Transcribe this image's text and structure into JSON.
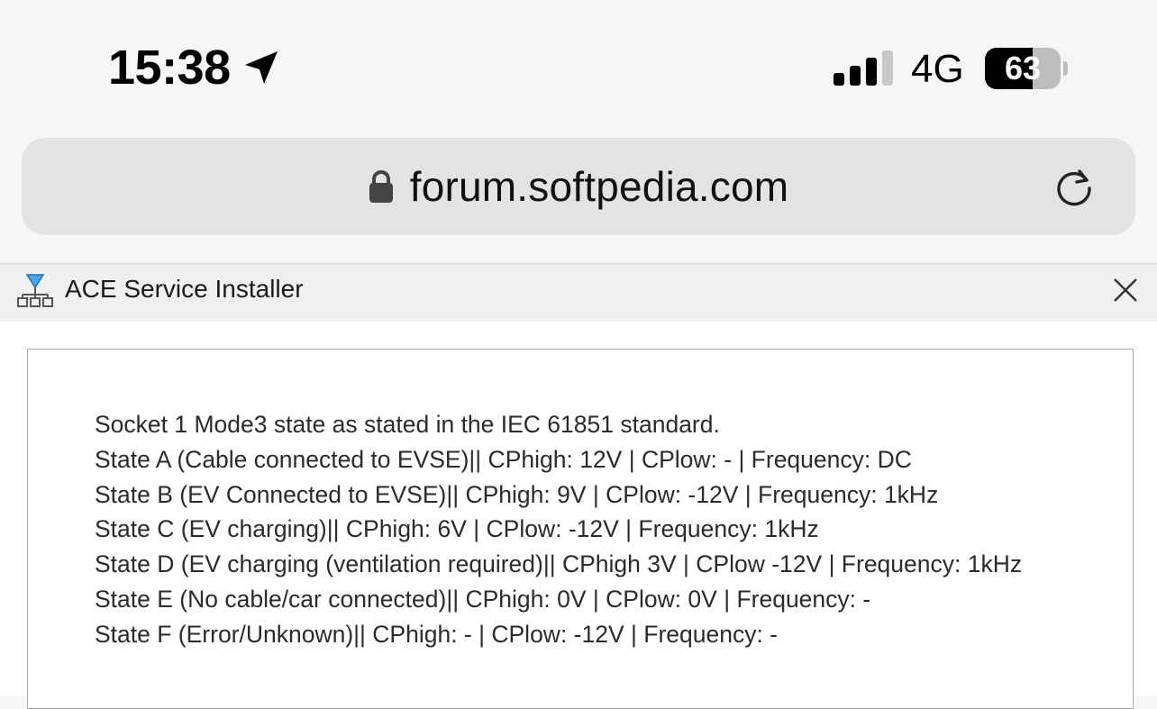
{
  "status_bar": {
    "time": "15:38",
    "location_icon": "location-arrow-icon",
    "signal_icon": "cellular-signal-icon",
    "signal_bars_active": 3,
    "signal_bars_total": 4,
    "network": "4G",
    "battery_percent": "63",
    "battery_level": 0.63
  },
  "browser": {
    "lock_icon": "lock-icon",
    "url": "forum.softpedia.com",
    "reload_icon": "reload-icon"
  },
  "installer": {
    "app_icon": "network-icon",
    "title": "ACE Service Installer",
    "close_icon": "close-icon",
    "lines": [
      "Socket 1 Mode3 state as stated in the IEC 61851 standard.",
      "State A (Cable connected to EVSE)|| CPhigh: 12V | CPlow: - | Frequency: DC",
      "State B (EV Connected to EVSE)|| CPhigh: 9V | CPlow: -12V | Frequency: 1kHz",
      "State C (EV charging)|| CPhigh: 6V | CPlow: -12V | Frequency: 1kHz",
      "State D (EV charging (ventilation required)|| CPhigh 3V | CPlow -12V | Frequency: 1kHz",
      "State E (No cable/car connected)|| CPhigh: 0V | CPlow: 0V | Frequency: -",
      "State F (Error/Unknown)|| CPhigh: - | CPlow: -12V | Frequency: -"
    ]
  },
  "colors": {
    "page_background": "#f6f6f6",
    "url_bar_background": "#e3e3e3",
    "titlebar_background": "#f0f0f0",
    "text": "#2b2b2b"
  }
}
